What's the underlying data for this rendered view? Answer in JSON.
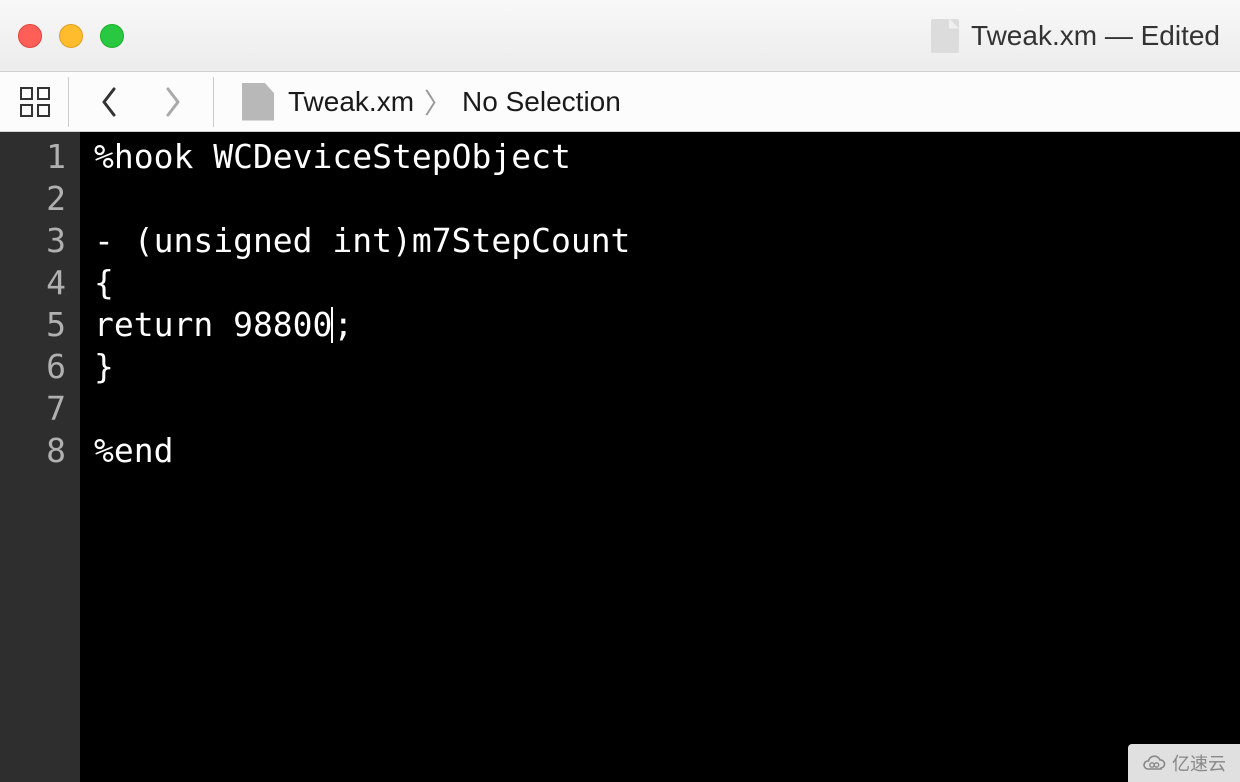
{
  "window": {
    "title": "Tweak.xm — Edited"
  },
  "breadcrumb": {
    "file": "Tweak.xm",
    "selection": "No Selection"
  },
  "code": {
    "lines": [
      "%hook WCDeviceStepObject",
      "",
      "- (unsigned int)m7StepCount",
      "{",
      "return 98800;",
      "}",
      "",
      "%end"
    ],
    "cursor_line": 5,
    "cursor_after": "return 98800"
  },
  "watermark": {
    "text": "亿速云"
  }
}
